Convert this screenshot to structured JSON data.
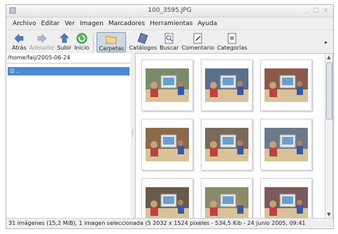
{
  "window": {
    "title": "100_3595.JPG",
    "controls": "_ □ x"
  },
  "menubar": [
    "Archivo",
    "Editar",
    "Ver",
    "Imagen",
    "Marcadores",
    "Herramientas",
    "Ayuda"
  ],
  "toolbar": {
    "back": "Atrás",
    "forward": "Adelante",
    "up": "Subir",
    "home": "Inicio",
    "folders": "Carpetas",
    "catalogs": "Catálogos",
    "search": "Buscar",
    "comment": "Comentario",
    "categories": "Categorías",
    "more": "▸"
  },
  "left_pane": {
    "path": "/home/falj/2005-06-24",
    "tree_item": ".."
  },
  "thumbnails": [
    {
      "subject": "classroom-computer",
      "color": "#7a8a6a"
    },
    {
      "subject": "classroom-computer",
      "color": "#5a6f8a"
    },
    {
      "subject": "classroom-computer",
      "color": "#8a5a4a"
    },
    {
      "subject": "classroom-computer",
      "color": "#8a6a4a"
    },
    {
      "subject": "classroom-computer",
      "color": "#7a6a5a"
    },
    {
      "subject": "classroom-computer",
      "color": "#6a7a8a"
    },
    {
      "subject": "classroom-computer",
      "color": "#6a5a4a"
    },
    {
      "subject": "classroom-computer",
      "color": "#8a8a6a"
    },
    {
      "subject": "classroom-computer",
      "color": "#7a5a5a"
    }
  ],
  "status": "31 imágenes (15,2 MiB), 1 imagen seleccionada (5 2032 x 1524 píxeles - 534,5 Kib - 24 junio 2005, 09:41"
}
